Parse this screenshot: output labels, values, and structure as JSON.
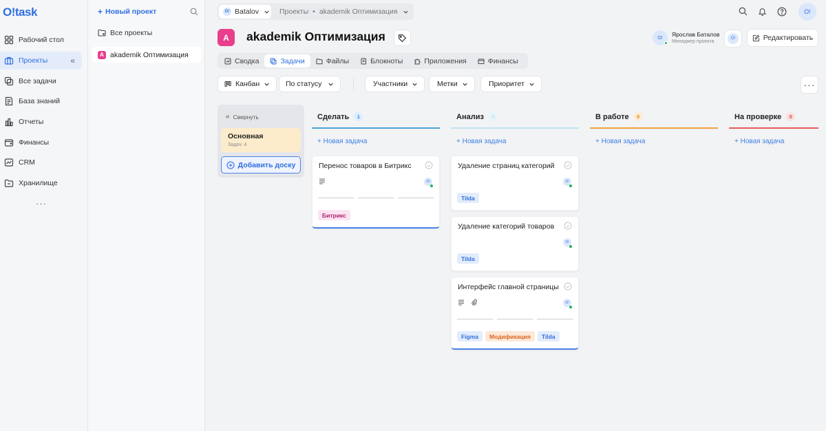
{
  "app": {
    "logo": "O!task"
  },
  "nav": {
    "items": [
      {
        "label": "Рабочий стол",
        "icon": "dashboard-icon"
      },
      {
        "label": "Проекты",
        "icon": "briefcase-icon"
      },
      {
        "label": "Все задачи",
        "icon": "tasks-icon"
      },
      {
        "label": "База знаний",
        "icon": "knowledge-icon"
      },
      {
        "label": "Отчеты",
        "icon": "reports-icon"
      },
      {
        "label": "Финансы",
        "icon": "wallet-icon"
      },
      {
        "label": "CRM",
        "icon": "crm-icon"
      },
      {
        "label": "Хранилище",
        "icon": "folder-icon"
      }
    ],
    "collapse": "«",
    "more": "···"
  },
  "projects_panel": {
    "new_project": "Новый проект",
    "all_projects": "Все проекты",
    "project": {
      "badge": "A",
      "name": "akademik Оптимизация"
    }
  },
  "topbar": {
    "workspace_avatar": "O!",
    "workspace": "Batalov",
    "crumb_projects": "Проекты",
    "crumb_sep": "•",
    "crumb_project": "akademik Оптимизация",
    "user_avatar": "O!"
  },
  "project_header": {
    "letter": "A",
    "title": "akademik Оптимизация",
    "manager_avatar": "O!",
    "manager_name": "Ярослав Баталов",
    "manager_role": "Менеджер проекта",
    "user_avatar": "O!",
    "edit_label": "Редактировать"
  },
  "tabs": [
    {
      "label": "Сводка",
      "icon": "summary-icon",
      "active": false
    },
    {
      "label": "Задачи",
      "icon": "tasks-icon",
      "active": true
    },
    {
      "label": "Файлы",
      "icon": "folder-icon",
      "active": false
    },
    {
      "label": "Блокноты",
      "icon": "notebook-icon",
      "active": false
    },
    {
      "label": "Приложения",
      "icon": "puzzle-icon",
      "active": false
    },
    {
      "label": "Финансы",
      "icon": "wallet-icon",
      "active": false
    }
  ],
  "toolbar": {
    "view": "Канбан",
    "group": "По статусу",
    "members": "Участники",
    "labels": "Метки",
    "priority": "Приоритет",
    "more": "···"
  },
  "boards": {
    "collapse_label": "Свернуть",
    "board_name": "Основная",
    "board_count": "Задач: 4",
    "add_board": "Добавить доску"
  },
  "columns": [
    {
      "title": "Сделать",
      "count": "1",
      "line_color": "#4aa3d9",
      "count_bg": "#dcefff",
      "count_fg": "#3f7fe6",
      "new_task": "+ Новая задача",
      "cards": [
        {
          "title": "Перенос товаров в Битрикс",
          "avatar": "O!",
          "has_desc": true,
          "has_attach": false,
          "has_progress": true,
          "tags": [
            {
              "label": "Битрикс",
              "bg": "#fbe4f1",
              "fg": "#b4236f"
            }
          ]
        }
      ]
    },
    {
      "title": "Анализ",
      "count": "3",
      "line_color": "#bfe3f0",
      "count_bg": "#e6f4fb",
      "count_fg": "#bfe3f0",
      "new_task": "+ Новая задача",
      "cards": [
        {
          "title": "Удаление страниц категорий",
          "avatar": "O!",
          "has_desc": false,
          "has_attach": false,
          "has_progress": false,
          "tags": [
            {
              "label": "Tilda",
              "bg": "#e2ecfb",
              "fg": "#2f6fe0"
            }
          ]
        },
        {
          "title": "Удаление категорий товаров",
          "avatar": "O!",
          "has_desc": false,
          "has_attach": false,
          "has_progress": false,
          "tags": [
            {
              "label": "Tilda",
              "bg": "#e2ecfb",
              "fg": "#2f6fe0"
            }
          ]
        },
        {
          "title": "Интерфейс главной страницы",
          "avatar": "O!",
          "has_desc": true,
          "has_attach": true,
          "has_progress": true,
          "tags": [
            {
              "label": "Figma",
              "bg": "#e2ecfb",
              "fg": "#2f6fe0"
            },
            {
              "label": "Модификация",
              "bg": "#fde9d9",
              "fg": "#d9651a"
            },
            {
              "label": "Tilda",
              "bg": "#e2ecfb",
              "fg": "#2f6fe0"
            }
          ]
        }
      ]
    },
    {
      "title": "В работе",
      "count": "0",
      "line_color": "#f0a23a",
      "count_bg": "#fdebd3",
      "count_fg": "#e08a1a",
      "new_task": "+ Новая задача",
      "cards": []
    },
    {
      "title": "На проверке",
      "count": "0",
      "line_color": "#e85a5a",
      "count_bg": "#fbe0e0",
      "count_fg": "#d94242",
      "new_task": "+ Новая задача",
      "cards": []
    }
  ]
}
